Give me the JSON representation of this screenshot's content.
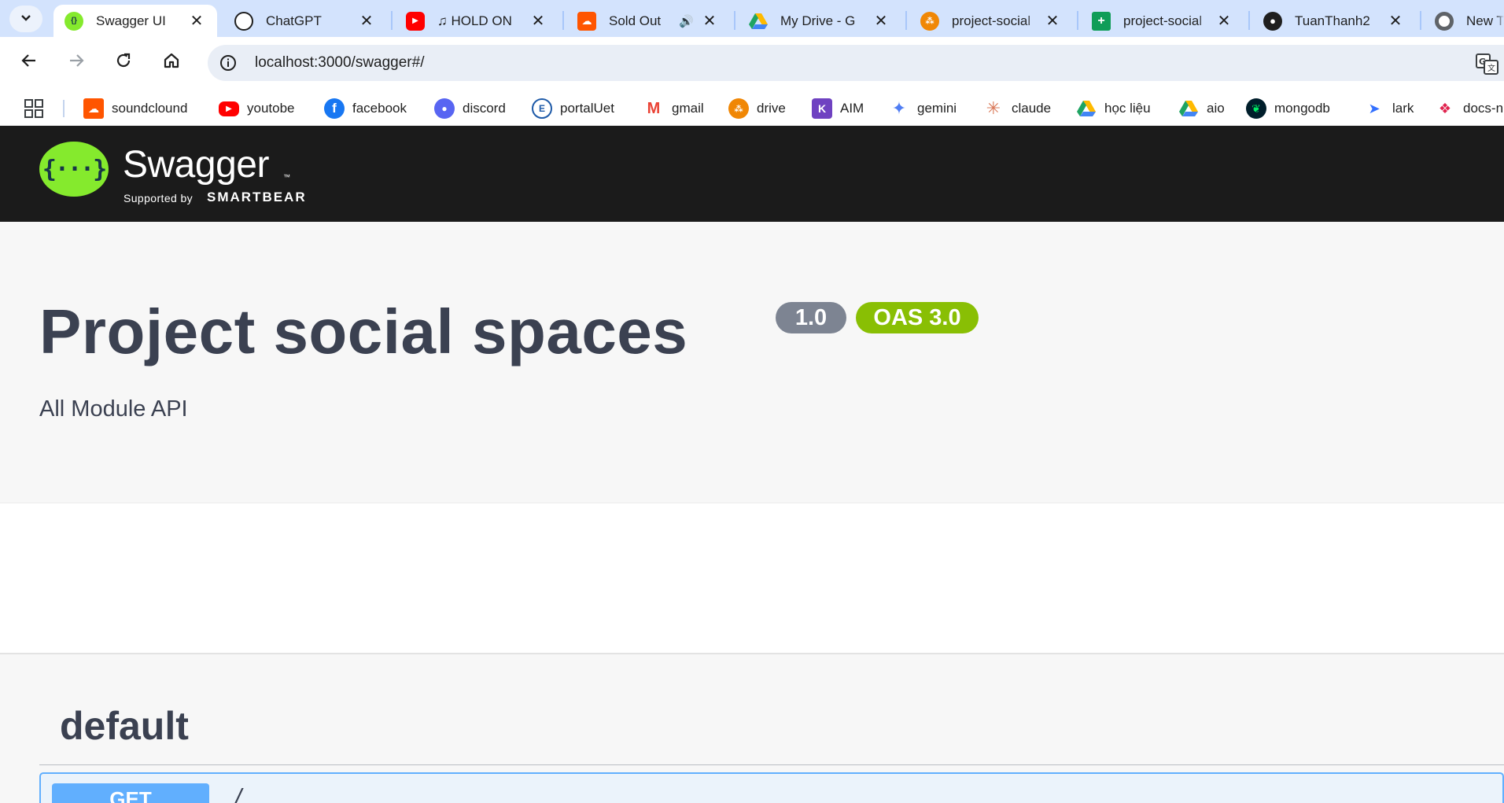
{
  "browser": {
    "tabs": [
      {
        "title": "Swagger UI",
        "icon": "swagger-favicon",
        "color": "#85ea2d",
        "active": true
      },
      {
        "title": "ChatGPT",
        "icon": "chatgpt-favicon",
        "color": "#1f1f1f"
      },
      {
        "title": "♫ HOLD ON",
        "icon": "youtube-favicon",
        "color": "#ff0000"
      },
      {
        "title": "Sold Out",
        "icon": "soundcloud-favicon",
        "color": "#ff5500",
        "audio": true
      },
      {
        "title": "My Drive - G",
        "icon": "google-drive-favicon",
        "color": "#1fa463"
      },
      {
        "title": "project-social",
        "icon": "drawio-favicon",
        "color": "#f08705"
      },
      {
        "title": "project-social",
        "icon": "google-sheets-favicon",
        "color": "#0f9d58"
      },
      {
        "title": "TuanThanh2",
        "icon": "github-favicon",
        "color": "#1f1f1f"
      },
      {
        "title": "New Tab",
        "icon": "chrome-favicon",
        "color": "#5f6368"
      }
    ],
    "url": "localhost:3000/swagger#/",
    "bookmarks": [
      {
        "label": "soundclound",
        "icon": "soundcloud-icon",
        "color": "#ff5500"
      },
      {
        "label": "youtobe",
        "icon": "youtube-icon",
        "color": "#ff0000"
      },
      {
        "label": "facebook",
        "icon": "facebook-icon",
        "color": "#1877f2"
      },
      {
        "label": "discord",
        "icon": "discord-icon",
        "color": "#5865f2"
      },
      {
        "label": "portalUet",
        "icon": "portal-icon",
        "color": "#1e5aa8"
      },
      {
        "label": "gmail",
        "icon": "gmail-icon",
        "color": "#ea4335"
      },
      {
        "label": "drive",
        "icon": "drawio-icon",
        "color": "#f08705"
      },
      {
        "label": "AIM",
        "icon": "aim-icon",
        "color": "#6f42c1"
      },
      {
        "label": "gemini",
        "icon": "gemini-icon",
        "color": "#4f7df3"
      },
      {
        "label": "claude",
        "icon": "claude-icon",
        "color": "#d97757"
      },
      {
        "label": "học liệu",
        "icon": "google-drive-icon",
        "color": "#1fa463"
      },
      {
        "label": "aio",
        "icon": "google-drive-icon",
        "color": "#1fa463"
      },
      {
        "label": "mongodb",
        "icon": "mongodb-icon",
        "color": "#00684a"
      },
      {
        "label": "lark",
        "icon": "lark-icon",
        "color": "#3370ff"
      },
      {
        "label": "docs-n",
        "icon": "nest-icon",
        "color": "#e0234e"
      }
    ]
  },
  "swagger": {
    "logo_text": "Swagger",
    "logo_tm": "™",
    "logo_braces": "{···}",
    "supported_by": "Supported by",
    "smartbear": "SMARTBEAR",
    "title": "Project social spaces",
    "version_badge": "1.0",
    "oas_badge": "OAS 3.0",
    "description": "All Module API",
    "tag": "default",
    "operation": {
      "method": "GET",
      "path": "/"
    },
    "colors": {
      "topbar": "#1b1b1b",
      "logo": "#85ea2d",
      "version": "#7d8492",
      "oas": "#89bf04",
      "get": "#61affe"
    }
  }
}
